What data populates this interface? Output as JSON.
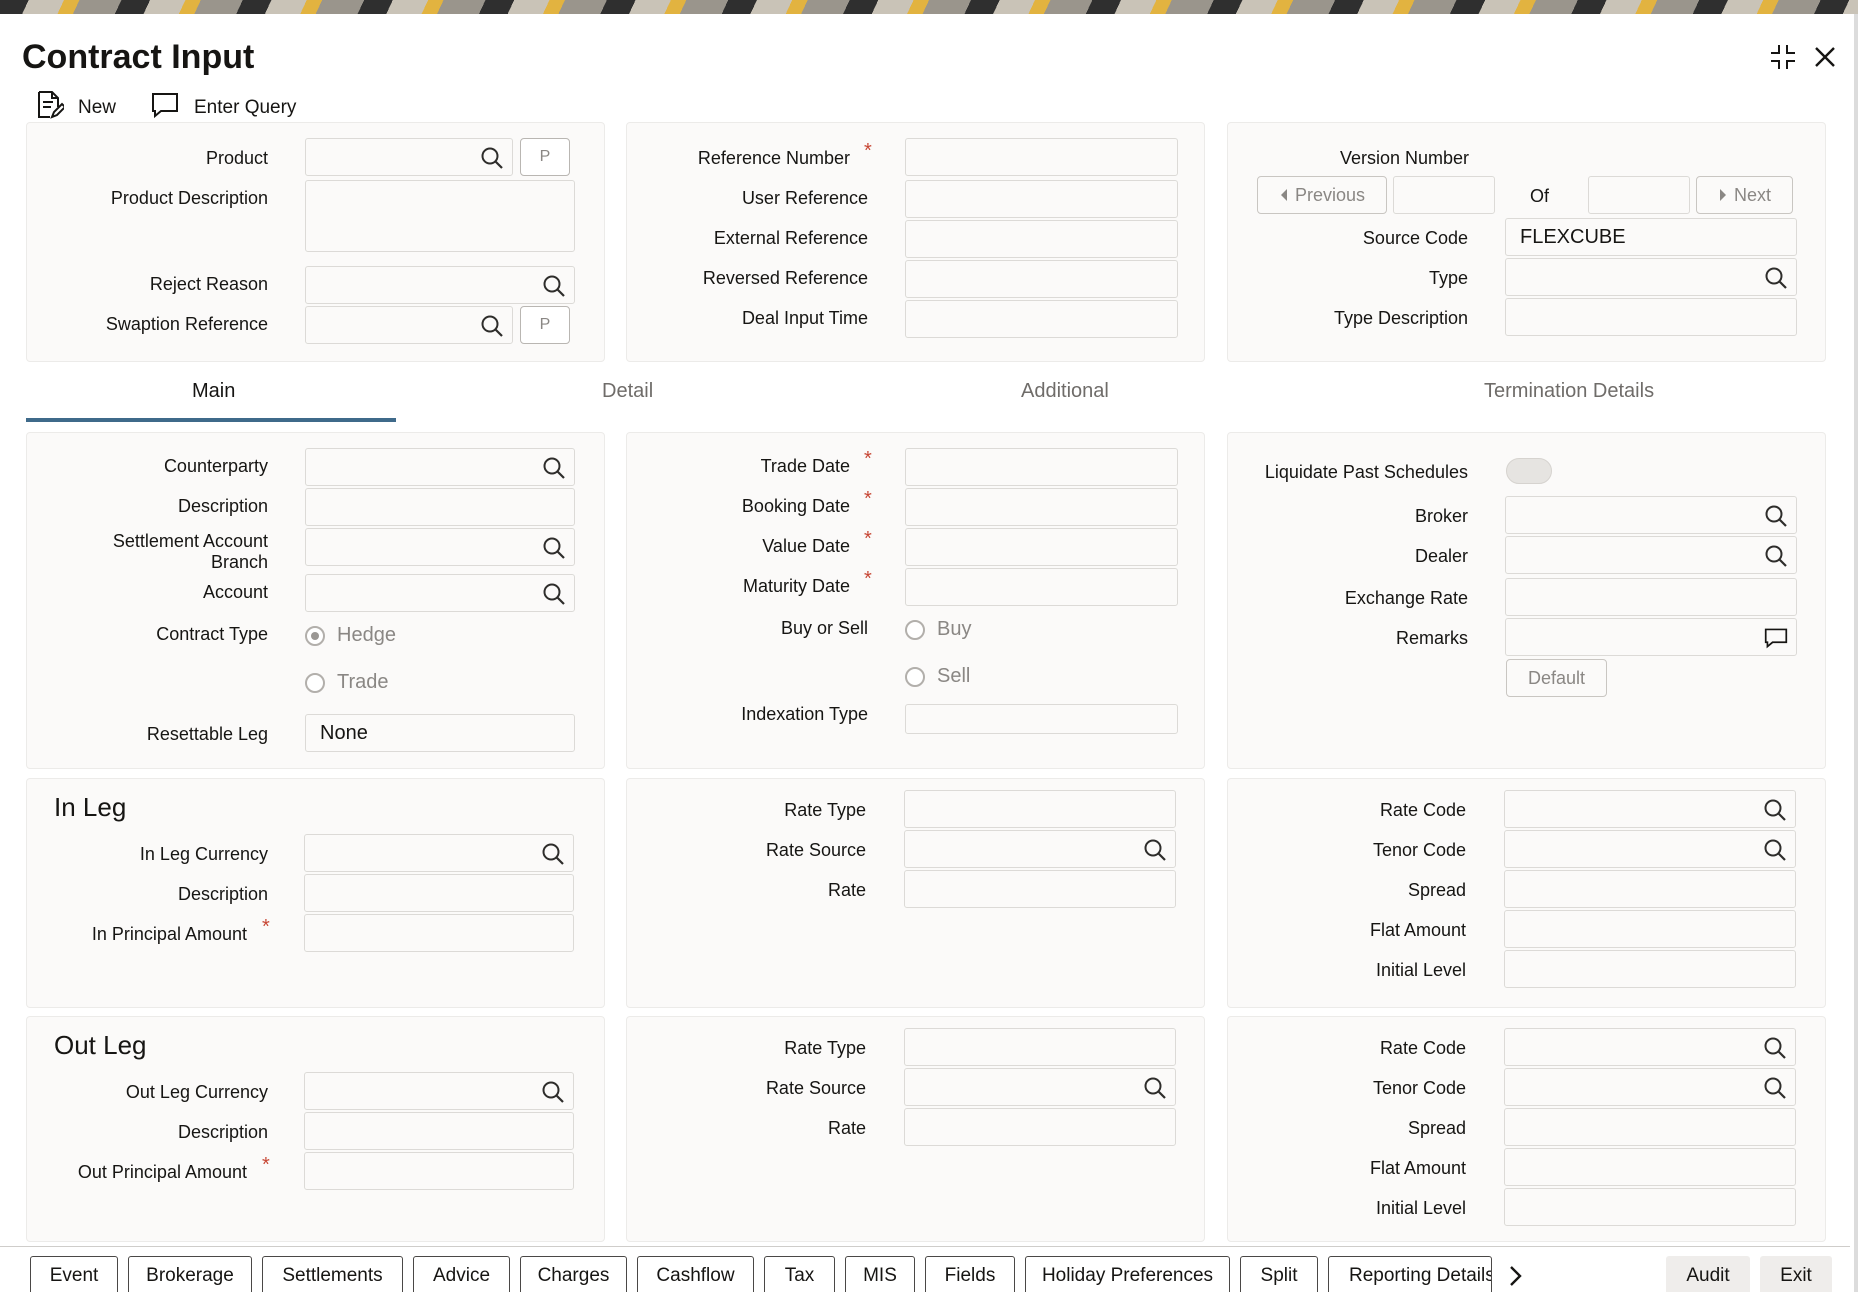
{
  "window": {
    "title": "Contract Input"
  },
  "toolbar": {
    "new_label": "New",
    "enter_query_label": "Enter Query"
  },
  "header_left": {
    "product_label": "Product",
    "product_value": "",
    "p_label": "P",
    "product_description_label": "Product Description",
    "reject_reason_label": "Reject Reason",
    "swaption_reference_label": "Swaption Reference"
  },
  "header_mid": {
    "reference_number_label": "Reference Number",
    "user_reference_label": "User Reference",
    "external_reference_label": "External Reference",
    "reversed_reference_label": "Reversed Reference",
    "deal_input_time_label": "Deal Input Time"
  },
  "header_right": {
    "version_number_label": "Version Number",
    "previous_label": "Previous",
    "of_label": "Of",
    "next_label": "Next",
    "source_code_label": "Source Code",
    "source_code_value": "FLEXCUBE",
    "type_label": "Type",
    "type_description_label": "Type Description"
  },
  "tabs": [
    {
      "label": "Main"
    },
    {
      "label": "Detail"
    },
    {
      "label": "Additional"
    },
    {
      "label": "Termination Details"
    }
  ],
  "main_left": {
    "counterparty_label": "Counterparty",
    "description_label": "Description",
    "settlement_account_branch_label": "Settlement Account Branch",
    "account_label": "Account",
    "contract_type_label": "Contract Type",
    "hedge_label": "Hedge",
    "trade_label": "Trade",
    "resettable_leg_label": "Resettable Leg",
    "resettable_leg_value": "None"
  },
  "main_mid": {
    "trade_date_label": "Trade Date",
    "booking_date_label": "Booking Date",
    "value_date_label": "Value Date",
    "maturity_date_label": "Maturity Date",
    "buy_or_sell_label": "Buy or Sell",
    "buy_label": "Buy",
    "sell_label": "Sell",
    "indexation_type_label": "Indexation Type"
  },
  "main_right": {
    "liquidate_past_schedules_label": "Liquidate Past Schedules",
    "broker_label": "Broker",
    "dealer_label": "Dealer",
    "exchange_rate_label": "Exchange Rate",
    "remarks_label": "Remarks",
    "default_label": "Default"
  },
  "in_leg": {
    "title": "In Leg",
    "currency_label": "In Leg Currency",
    "description_label": "Description",
    "principal_label": "In Principal Amount",
    "rate_type_label": "Rate Type",
    "rate_source_label": "Rate Source",
    "rate_label": "Rate",
    "rate_code_label": "Rate Code",
    "tenor_code_label": "Tenor Code",
    "spread_label": "Spread",
    "flat_amount_label": "Flat Amount",
    "initial_level_label": "Initial Level"
  },
  "out_leg": {
    "title": "Out Leg",
    "currency_label": "Out Leg Currency",
    "description_label": "Description",
    "principal_label": "Out Principal Amount",
    "rate_type_label": "Rate Type",
    "rate_source_label": "Rate Source",
    "rate_label": "Rate",
    "rate_code_label": "Rate Code",
    "tenor_code_label": "Tenor Code",
    "spread_label": "Spread",
    "flat_amount_label": "Flat Amount",
    "initial_level_label": "Initial Level"
  },
  "bottom_buttons": [
    "Event",
    "Brokerage",
    "Settlements",
    "Advice",
    "Charges",
    "Cashflow",
    "Tax",
    "MIS",
    "Fields",
    "Holiday Preferences",
    "Split",
    "Reporting Details"
  ],
  "footer": {
    "audit_label": "Audit",
    "exit_label": "Exit"
  },
  "icons": [
    "document-new-icon",
    "comment-icon",
    "search-icon",
    "collapse-icon",
    "close-icon",
    "chevron-right-icon"
  ],
  "colors": {
    "required": "#c74634",
    "tab_active_underline": "#3f6a8a",
    "panel_bg": "#fbfaf9"
  }
}
